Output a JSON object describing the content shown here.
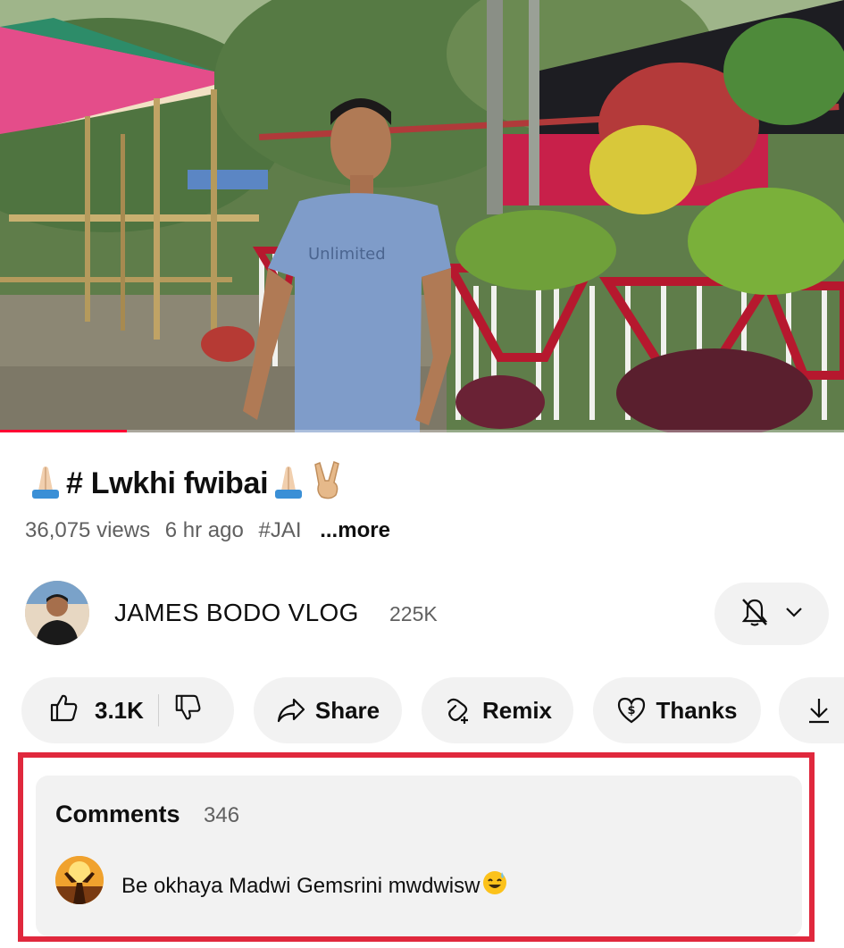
{
  "video": {
    "progress": 0.15,
    "shirt_text": "Unlimited"
  },
  "title": {
    "text": "# Lwkhi fwibai"
  },
  "meta": {
    "views": "36,075 views",
    "age": "6 hr ago",
    "hashtag": "#JAI",
    "more": "...more"
  },
  "channel": {
    "name": "JAMES BODO VLOG",
    "subscribers": "225K"
  },
  "actions": {
    "likes": "3.1K",
    "share": "Share",
    "remix": "Remix",
    "thanks": "Thanks"
  },
  "comments": {
    "label": "Comments",
    "count": "346",
    "top_comment": "Be okhaya Madwi Gemsrini mwdwisw"
  },
  "colors": {
    "highlight_border": "#e0283d",
    "progress": "#ff0033",
    "pill_bg": "#f2f2f2"
  }
}
